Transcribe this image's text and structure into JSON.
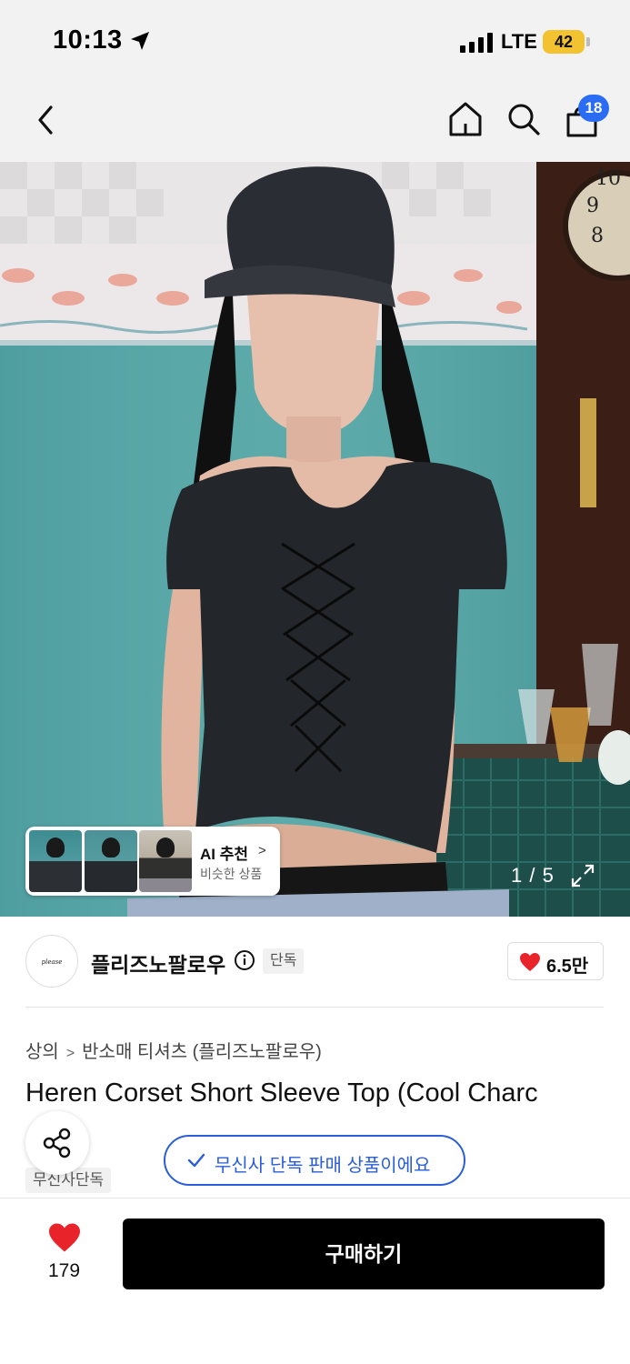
{
  "status_bar": {
    "time": "10:13",
    "network": "LTE",
    "battery": "42"
  },
  "header": {
    "cart_count": "18"
  },
  "gallery": {
    "ai_label": "AI 추천",
    "ai_subtitle": "비슷한 상품",
    "page_counter": "1 / 5"
  },
  "brand": {
    "logo_text": "please NOFOLLOW",
    "name": "플리즈노팔로우",
    "tag": "단독",
    "likes": "6.5만"
  },
  "product": {
    "breadcrumb": [
      "상의",
      "반소매 티셔츠 (플리즈노팔로우)"
    ],
    "title": "Heren Corset Short Sleeve Top (Cool Charc",
    "store_tag": "무신사단독",
    "exclusive_banner": "무신사 단독 판매 상품이에요"
  },
  "bottom_bar": {
    "wish_count": "179",
    "buy_label": "구매하기"
  },
  "colors": {
    "accent_blue": "#2a5dd8",
    "badge_blue": "#2a6df4",
    "heart_red": "#e8232a",
    "buy_black": "#000000"
  }
}
